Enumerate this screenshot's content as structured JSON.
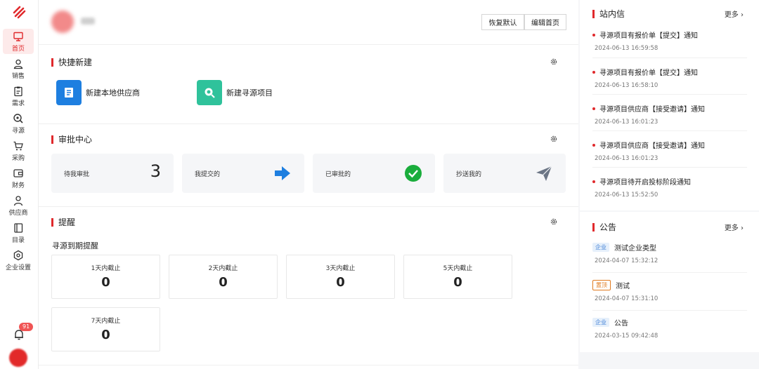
{
  "nav": {
    "items": [
      {
        "label": "首页",
        "icon": "monitor-icon"
      },
      {
        "label": "销售",
        "icon": "user-icon"
      },
      {
        "label": "需求",
        "icon": "clipboard-icon"
      },
      {
        "label": "寻源",
        "icon": "search-icon"
      },
      {
        "label": "采购",
        "icon": "cart-icon"
      },
      {
        "label": "财务",
        "icon": "wallet-icon"
      },
      {
        "label": "供应商",
        "icon": "person-icon"
      },
      {
        "label": "目录",
        "icon": "book-icon"
      },
      {
        "label": "企业设置",
        "icon": "hexagon-gear-icon"
      }
    ],
    "notification_count": "91"
  },
  "header": {
    "reset_label": "恢复默认",
    "edit_label": "编辑首页"
  },
  "quick": {
    "title": "快捷新建",
    "items": [
      {
        "label": "新建本地供应商",
        "color": "#1e7fe0"
      },
      {
        "label": "新建寻源项目",
        "color": "#2fc29b"
      }
    ]
  },
  "approval": {
    "title": "审批中心",
    "cards": [
      {
        "label": "待我审批",
        "value": "3"
      },
      {
        "label": "我提交的"
      },
      {
        "label": "已审批的"
      },
      {
        "label": "抄送我的"
      }
    ]
  },
  "reminder": {
    "title": "提醒",
    "subtitle": "寻源到期提醒",
    "cards": [
      {
        "label": "1天内截止",
        "value": "0"
      },
      {
        "label": "2天内截止",
        "value": "0"
      },
      {
        "label": "3天内截止",
        "value": "0"
      },
      {
        "label": "5天内截止",
        "value": "0"
      },
      {
        "label": "7天内截止",
        "value": "0"
      }
    ]
  },
  "inbox": {
    "title": "站内信",
    "more": "更多",
    "messages": [
      {
        "title": "寻源项目有报价单【提交】通知",
        "date": "2024-06-13 16:59:58"
      },
      {
        "title": "寻源项目有报价单【提交】通知",
        "date": "2024-06-13 16:58:10"
      },
      {
        "title": "寻源项目供应商【接受邀请】通知",
        "date": "2024-06-13 16:01:23"
      },
      {
        "title": "寻源项目供应商【接受邀请】通知",
        "date": "2024-06-13 16:01:23"
      },
      {
        "title": "寻源项目待开启投标阶段通知",
        "date": "2024-06-13 15:52:50"
      }
    ]
  },
  "notice": {
    "title": "公告",
    "more": "更多",
    "items": [
      {
        "tag": "企业",
        "title": "测试企业类型",
        "date": "2024-04-07 15:32:12"
      },
      {
        "tag": "置顶",
        "title": "测试",
        "date": "2024-04-07 15:31:10"
      },
      {
        "tag": "企业",
        "title": "公告",
        "date": "2024-03-15 09:42:48"
      }
    ]
  },
  "colors": {
    "accent": "#e0292c",
    "success": "#1aad3c",
    "blue": "#1e7fe0"
  }
}
